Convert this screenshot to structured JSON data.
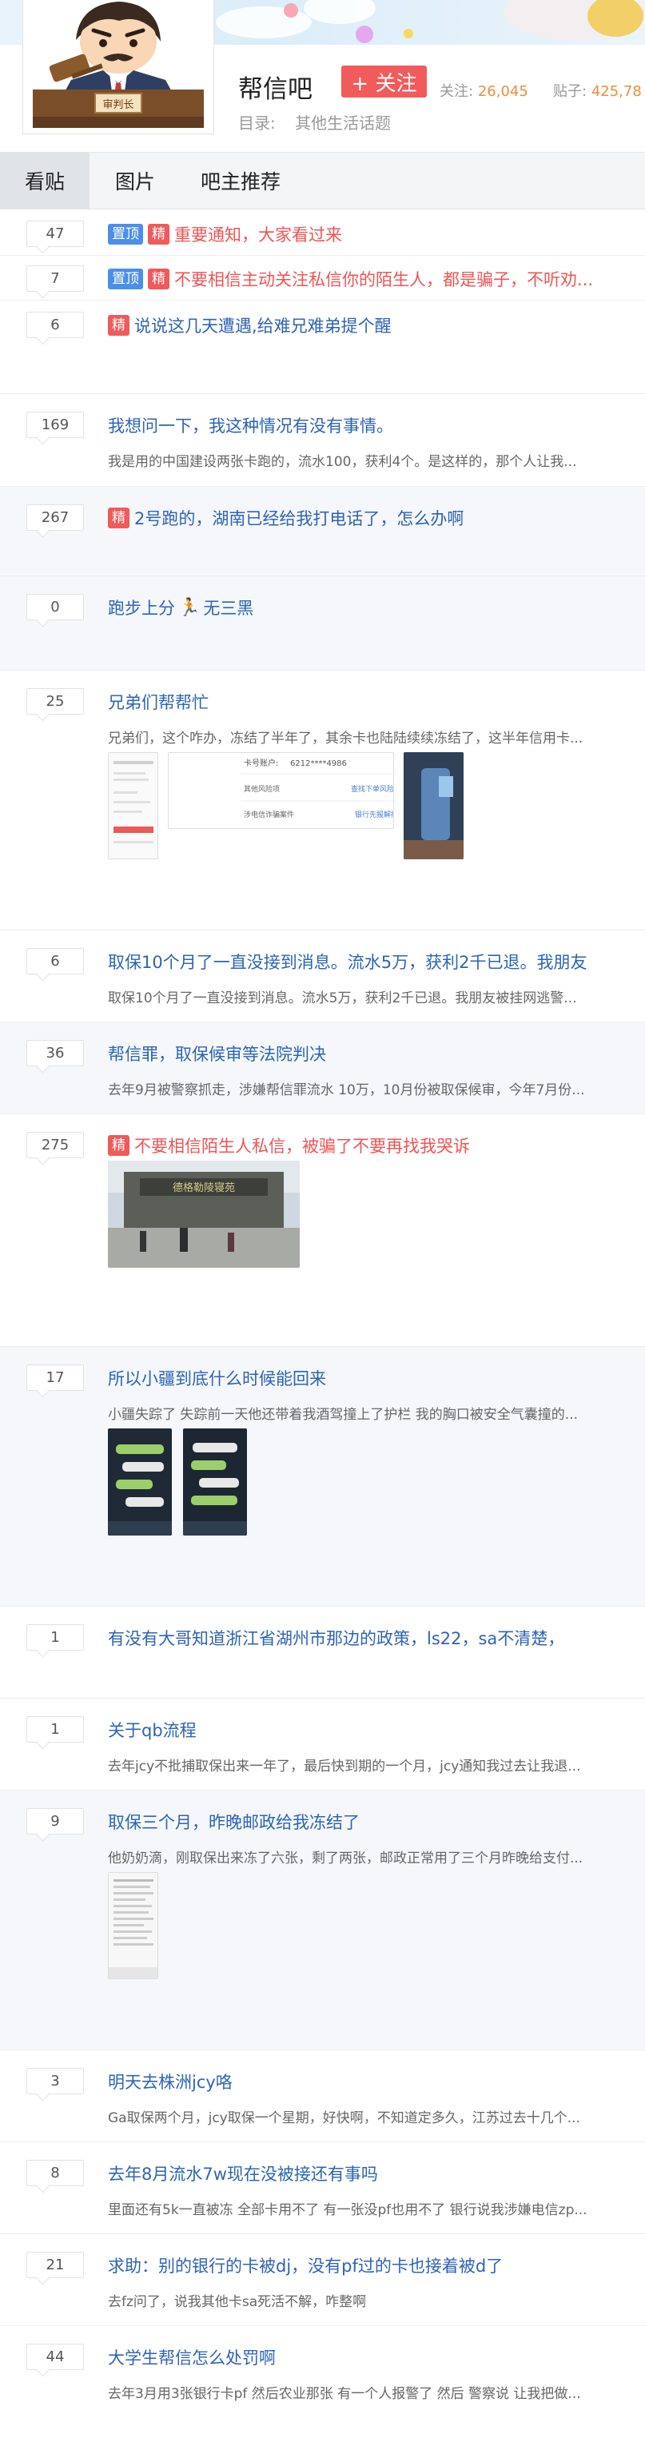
{
  "forum": {
    "avatar_sign": "审判长",
    "name": "帮信吧",
    "follow_label": "+ 关注",
    "follow_stat_label": "关注:",
    "follow_stat_value": "26,045",
    "posts_stat_label": "贴子:",
    "posts_stat_value": "425,78",
    "catalog_label": "目录:",
    "catalog_value": "其他生活话题"
  },
  "tabs": [
    {
      "label": "看贴"
    },
    {
      "label": "图片"
    },
    {
      "label": "吧主推荐"
    }
  ],
  "threads": [
    {
      "replies": "47",
      "badges": [
        "置顶",
        "精"
      ],
      "title": "重要通知，大家看过来",
      "title_color": "red",
      "abstract": ""
    },
    {
      "replies": "7",
      "badges": [
        "置顶",
        "精"
      ],
      "title": "不要相信主动关注私信你的陌生人，都是骗子，不听劝...",
      "title_color": "red",
      "abstract": ""
    },
    {
      "replies": "6",
      "badges": [
        "精"
      ],
      "title": "说说这几天遭遇,给难兄难弟提个醒",
      "title_color": "blue",
      "abstract": ""
    },
    {
      "replies": "169",
      "badges": [],
      "title": "我想问一下，我这种情况有没有事情。",
      "title_color": "blue",
      "abstract": "我是用的中国建设两张卡跑的，流水100，获利4个。是这样的，那个人让我..."
    },
    {
      "replies": "267",
      "badges": [
        "精"
      ],
      "title": "2号跑的，湖南已经给我打电话了，怎么办啊",
      "title_color": "blue",
      "abstract": ""
    },
    {
      "replies": "0",
      "badges": [],
      "title": "跑步上分",
      "title_suffix": "无三黑",
      "emoji": "🏃",
      "title_color": "blue",
      "abstract": ""
    },
    {
      "replies": "25",
      "badges": [],
      "title": "兄弟们帮帮忙",
      "title_color": "blue",
      "abstract": "兄弟们，这个咋办，冻结了半年了，其余卡也陆陆续续冻结了，这半年信用卡...",
      "bank_card_label": "卡号账户:",
      "bank_card_value": "6212****4986",
      "bank_row1_left": "其他风险项",
      "bank_row1_right": "查找下单风险报",
      "bank_row2_left": "涉电信诈骗案件",
      "bank_row2_right": "银行先报解控"
    },
    {
      "replies": "6",
      "badges": [],
      "title": "取保10个月了一直没接到消息。流水5万，获利2千已退。我朋友",
      "title_color": "blue",
      "abstract": "取保10个月了一直没接到消息。流水5万，获利2千已退。我朋友被挂网逃警..."
    },
    {
      "replies": "36",
      "badges": [],
      "title": "帮信罪，取保候审等法院判决",
      "title_color": "blue",
      "abstract": "去年9月被警察抓走，涉嫌帮信罪流水 10万，10月份被取保候审，今年7月份..."
    },
    {
      "replies": "275",
      "badges": [
        "精"
      ],
      "title": "不要相信陌生人私信，被骗了不要再找我哭诉",
      "title_color": "red",
      "abstract": "",
      "photo_sign": "德格勒陵寝苑"
    },
    {
      "replies": "17",
      "badges": [],
      "title": "所以小疆到底什么时候能回来",
      "title_color": "blue",
      "abstract": "小疆失踪了 失踪前一天他还带着我酒驾撞上了护栏 我的胸口被安全气囊撞的..."
    },
    {
      "replies": "1",
      "badges": [],
      "title": "有没有大哥知道浙江省湖州市那边的政策，ls22，sa不清楚，",
      "title_color": "blue",
      "abstract": ""
    },
    {
      "replies": "1",
      "badges": [],
      "title": "关于qb流程",
      "title_color": "blue",
      "abstract": "去年jcy不批捕取保出来一年了，最后快到期的一个月，jcy通知我过去让我退..."
    },
    {
      "replies": "9",
      "badges": [],
      "title": "取保三个月，昨晚邮政给我冻结了",
      "title_color": "blue",
      "abstract": "他奶奶滴，刚取保出来冻了六张，剩了两张，邮政正常用了三个月昨晚给支付..."
    },
    {
      "replies": "3",
      "badges": [],
      "title": "明天去株洲jcy咯",
      "title_color": "blue",
      "abstract": "Ga取保两个月，jcy取保一个星期，好快啊，不知道定多久，江苏过去十几个..."
    },
    {
      "replies": "8",
      "badges": [],
      "title": "去年8月流水7w现在没被接还有事吗",
      "title_color": "blue",
      "abstract": "里面还有5k一直被冻 全部卡用不了 有一张没pf也用不了 银行说我涉嫌电信zp..."
    },
    {
      "replies": "21",
      "badges": [],
      "title": "求助：别的银行的卡被dj，没有pf过的卡也接着被d了",
      "title_color": "blue",
      "abstract": "去fz问了，说我其他卡sa死活不解，咋整啊"
    },
    {
      "replies": "44",
      "badges": [],
      "title": "大学生帮信怎么处罚啊",
      "title_color": "blue",
      "abstract": "去年3月用3张银行卡pf 然后农业那张 有一个人报警了 然后 警察说 让我把做..."
    }
  ]
}
